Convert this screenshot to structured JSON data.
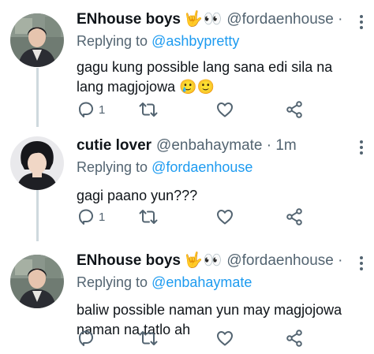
{
  "tweets": [
    {
      "display_name": "ENhouse boys",
      "emoji": [
        "🤟",
        "👀"
      ],
      "handle": "@fordaenhouse · ...",
      "reply_prefix": "Replying to",
      "reply_to": "@ashbypretty",
      "text_line1": "gagu kung possible lang sana edi sila na",
      "text_line2": "lang magjojowa 🥲🙂",
      "reply_count": "1",
      "retweet_count": "",
      "like_count": ""
    },
    {
      "display_name": "cutie lover",
      "emoji": [],
      "handle": "@enbahaymate · 1m",
      "reply_prefix": "Replying to",
      "reply_to": "@fordaenhouse",
      "text_line1": "gagi paano yun???",
      "reply_count": "1",
      "retweet_count": "",
      "like_count": ""
    },
    {
      "display_name": "ENhouse boys",
      "emoji": [
        "🤟",
        "👀"
      ],
      "handle": "@fordaenhouse · ...",
      "reply_prefix": "Replying to",
      "reply_to": "@enbahaymate",
      "text_line1": "baliw possible naman yun may magjojowa",
      "text_line2": "naman na tatlo ah",
      "reply_count": "",
      "retweet_count": "",
      "like_count": ""
    }
  ],
  "colors": {
    "link": "#1d9bf0",
    "secondary": "#536471",
    "thread_line": "#cfd9de"
  },
  "icons": [
    "reply-icon",
    "retweet-icon",
    "like-icon",
    "share-icon",
    "more-icon"
  ]
}
